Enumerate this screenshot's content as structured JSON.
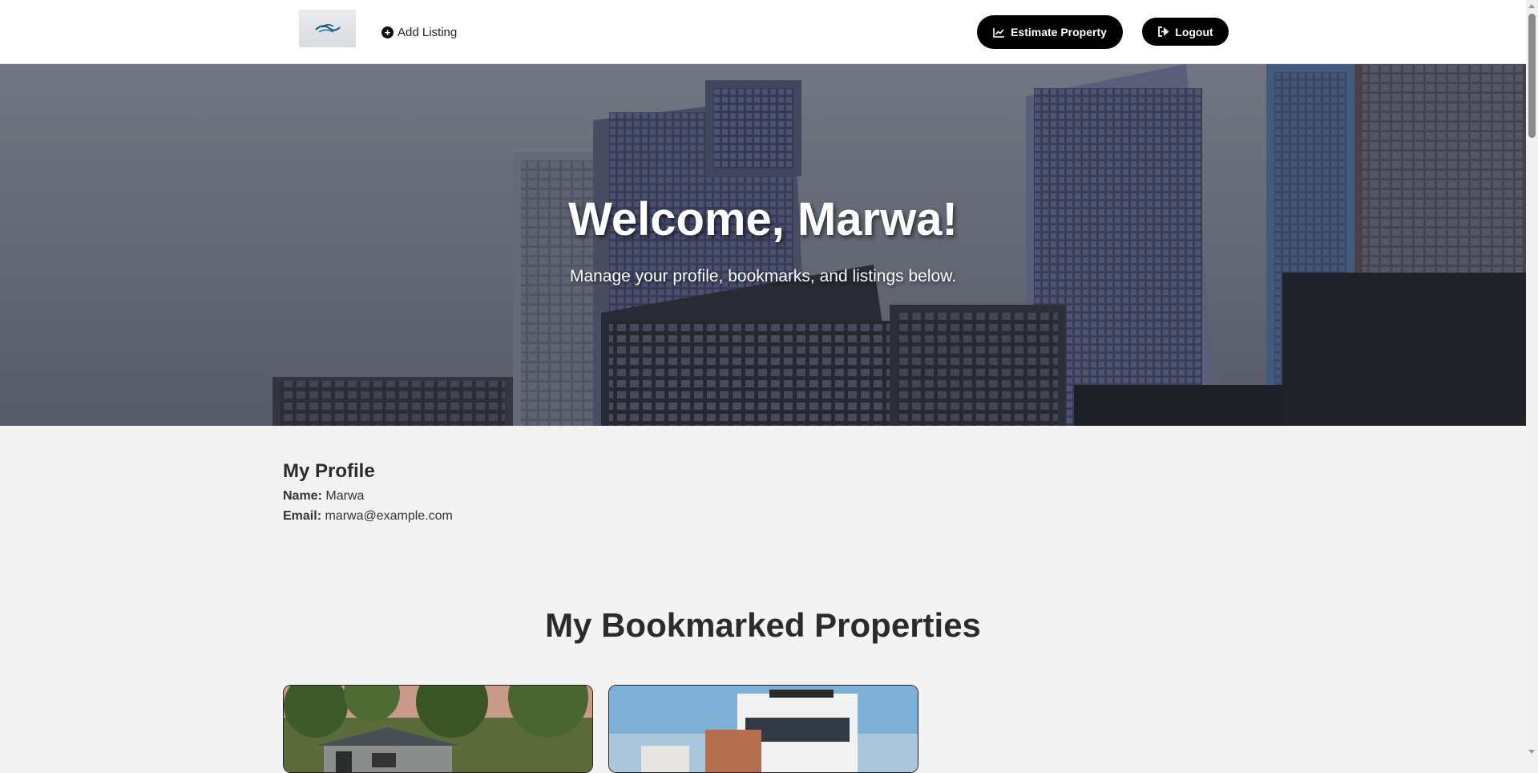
{
  "header": {
    "logo_icon": "wave-logo-icon",
    "add_listing_label": "Add Listing",
    "add_listing_icon": "plus-circle-icon",
    "estimate_label": "Estimate Property",
    "estimate_icon": "chart-line-icon",
    "logout_label": "Logout",
    "logout_icon": "sign-out-icon"
  },
  "hero": {
    "title": "Welcome, Marwa!",
    "subtitle": "Manage your profile, bookmarks, and listings below."
  },
  "profile": {
    "heading": "My Profile",
    "name_label": "Name:",
    "name_value": "Marwa",
    "email_label": "Email:",
    "email_value": "marwa@example.com"
  },
  "bookmarks": {
    "heading": "My Bookmarked Properties",
    "cards": [
      {
        "image": "house-in-trees-photo"
      },
      {
        "image": "modern-white-house-photo"
      }
    ]
  },
  "colors": {
    "button_bg": "#000000",
    "page_bg": "#f3f3f3",
    "header_bg": "#ffffff"
  }
}
